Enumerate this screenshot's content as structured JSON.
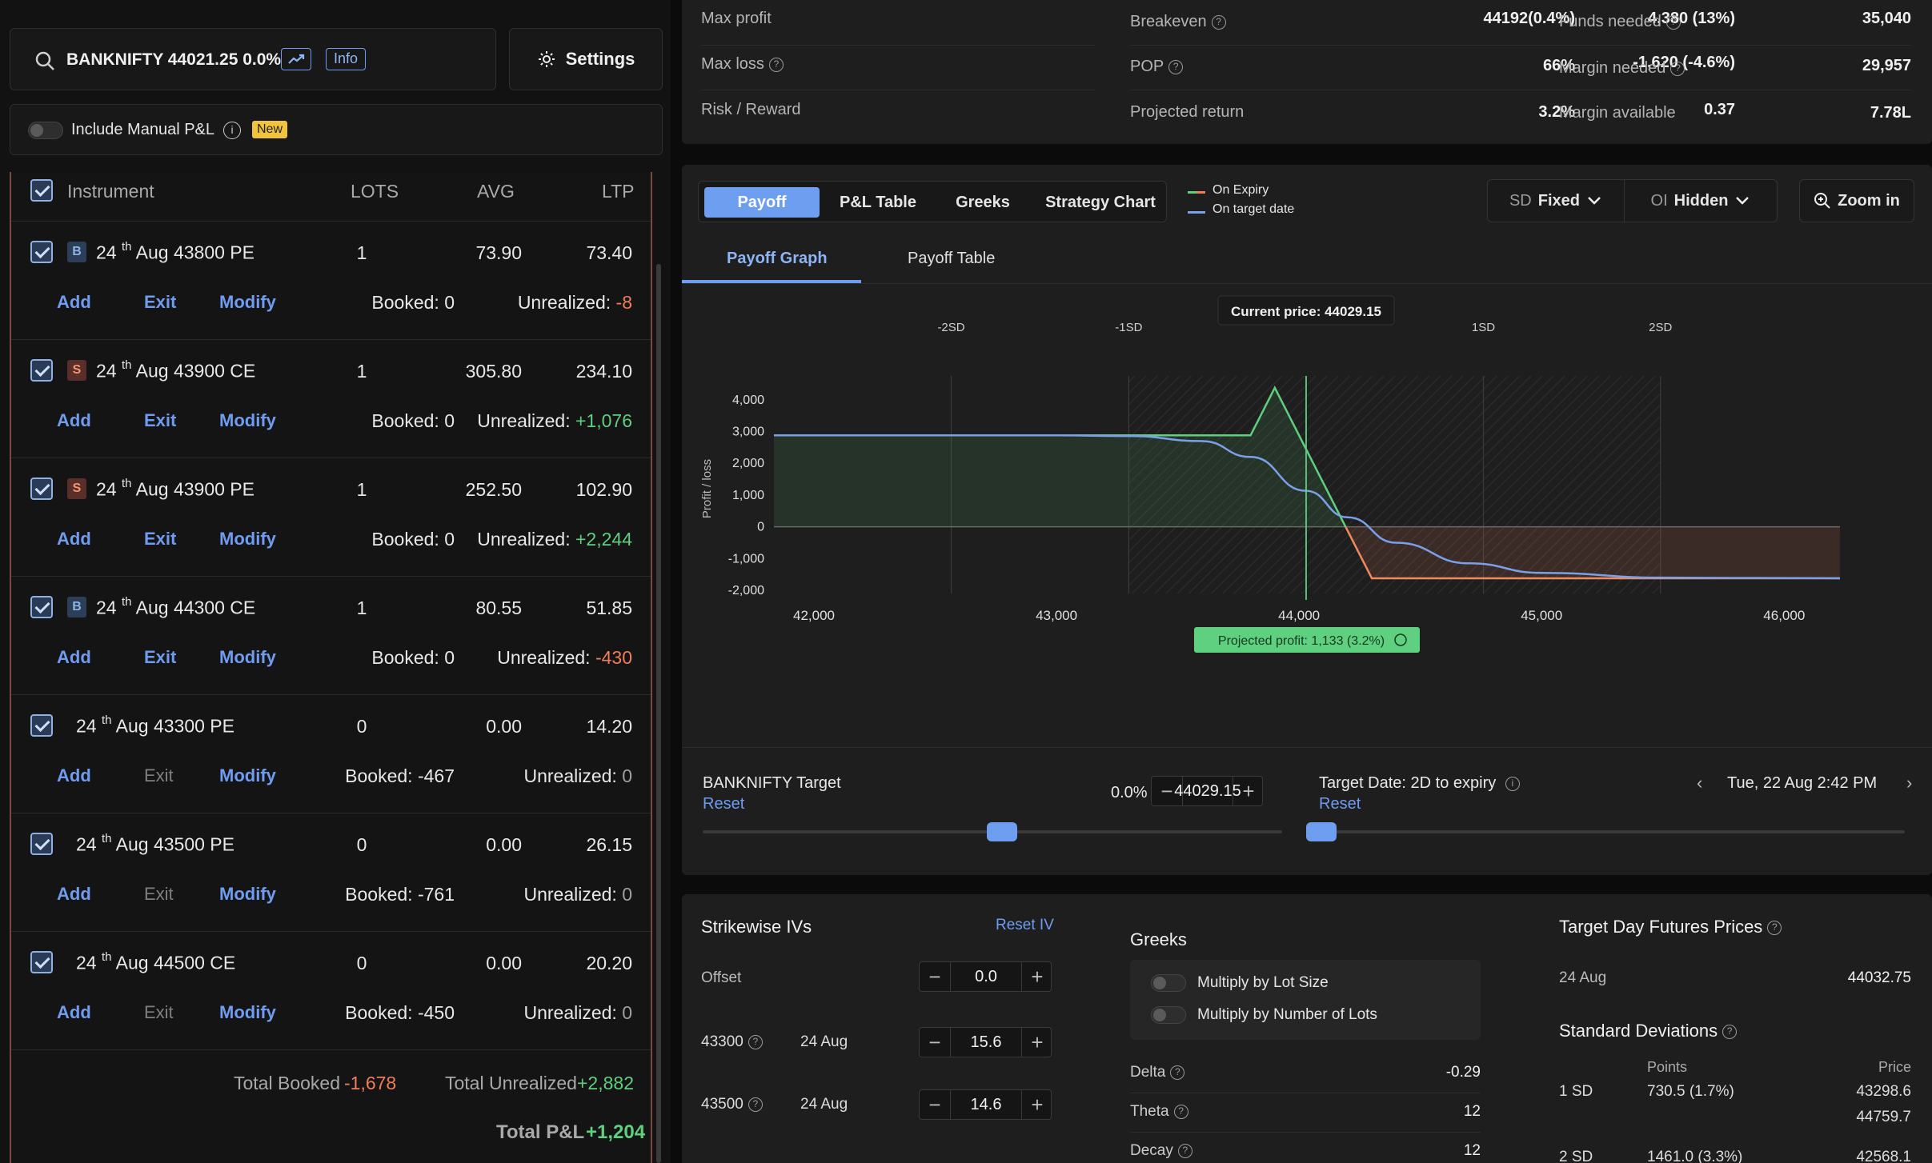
{
  "search": {
    "text": "BANKNIFTY 44021.25 0.0%",
    "info_label": "Info"
  },
  "settings_label": "Settings",
  "manual_pnl": {
    "label": "Include Manual P&L",
    "badge": "New"
  },
  "table": {
    "headers": {
      "instrument": "Instrument",
      "lots": "LOTS",
      "avg": "AVG",
      "ltp": "LTP"
    },
    "rows": [
      {
        "side": "B",
        "day": "24",
        "sup": "th",
        "rest": "Aug 43800 PE",
        "lots": "1",
        "avg": "73.90",
        "ltp": "73.40",
        "booked_label": "Booked:",
        "booked": "0",
        "unreal_label": "Unrealized:",
        "unreal": "-8",
        "unreal_color": "red",
        "exit_enabled": true
      },
      {
        "side": "S",
        "day": "24",
        "sup": "th",
        "rest": "Aug 43900 CE",
        "lots": "1",
        "avg": "305.80",
        "ltp": "234.10",
        "booked_label": "Booked:",
        "booked": "0",
        "unreal_label": "Unrealized:",
        "unreal": "+1,076",
        "unreal_color": "green",
        "exit_enabled": true
      },
      {
        "side": "S",
        "day": "24",
        "sup": "th",
        "rest": "Aug 43900 PE",
        "lots": "1",
        "avg": "252.50",
        "ltp": "102.90",
        "booked_label": "Booked:",
        "booked": "0",
        "unreal_label": "Unrealized:",
        "unreal": "+2,244",
        "unreal_color": "green",
        "exit_enabled": true
      },
      {
        "side": "B",
        "day": "24",
        "sup": "th",
        "rest": "Aug 44300 CE",
        "lots": "1",
        "avg": "80.55",
        "ltp": "51.85",
        "booked_label": "Booked:",
        "booked": "0",
        "unreal_label": "Unrealized:",
        "unreal": "-430",
        "unreal_color": "red",
        "exit_enabled": true
      },
      {
        "side": "",
        "day": "24",
        "sup": "th",
        "rest": "Aug 43300 PE",
        "lots": "0",
        "avg": "0.00",
        "ltp": "14.20",
        "booked_label": "Booked:",
        "booked": "-467",
        "unreal_label": "Unrealized:",
        "unreal": "0",
        "unreal_color": "muted",
        "exit_enabled": false
      },
      {
        "side": "",
        "day": "24",
        "sup": "th",
        "rest": "Aug 43500 PE",
        "lots": "0",
        "avg": "0.00",
        "ltp": "26.15",
        "booked_label": "Booked:",
        "booked": "-761",
        "unreal_label": "Unrealized:",
        "unreal": "0",
        "unreal_color": "muted",
        "exit_enabled": false
      },
      {
        "side": "",
        "day": "24",
        "sup": "th",
        "rest": "Aug 44500 CE",
        "lots": "0",
        "avg": "0.00",
        "ltp": "20.20",
        "booked_label": "Booked:",
        "booked": "-450",
        "unreal_label": "Unrealized:",
        "unreal": "0",
        "unreal_color": "muted",
        "exit_enabled": false
      }
    ],
    "actions": {
      "add": "Add",
      "exit": "Exit",
      "modify": "Modify"
    },
    "totals": {
      "booked_label": "Total Booked",
      "booked": "-1,678",
      "unreal_label": "Total Unrealized",
      "unreal": "+2,882",
      "pnl_label": "Total P&L",
      "pnl": "+1,204"
    }
  },
  "stats": {
    "max_profit": {
      "label": "Max profit",
      "value": "4,380 (13%)"
    },
    "max_loss": {
      "label": "Max loss",
      "value": "-1,620 (-4.6%)"
    },
    "risk_reward": {
      "label": "Risk / Reward",
      "value": "0.37"
    },
    "breakeven": {
      "label": "Breakeven",
      "value": "44192(0.4%)"
    },
    "pop": {
      "label": "POP",
      "value": "66%"
    },
    "projected_return": {
      "label": "Projected return",
      "value": "3.2%"
    },
    "funds_needed": {
      "label": "Funds needed",
      "value": "35,040"
    },
    "margin_needed": {
      "label": "Margin needed",
      "value": "29,957"
    },
    "margin_available": {
      "label": "Margin available",
      "value": "7.78L"
    }
  },
  "chart_tabs": [
    "Payoff",
    "P&L Table",
    "Greeks",
    "Strategy Chart"
  ],
  "legend": {
    "expiry": "On Expiry",
    "target": "On target date"
  },
  "sd_select": {
    "prefix": "SD",
    "value": "Fixed"
  },
  "oi_select": {
    "prefix": "OI",
    "value": "Hidden"
  },
  "zoom_label": "Zoom in",
  "subtabs": [
    "Payoff Graph",
    "Payoff Table"
  ],
  "chart_data": {
    "type": "line",
    "current_price_label": "Current price: 44029.15",
    "current_price": 44029.15,
    "ylabel": "Profit / loss",
    "xlim": [
      41835,
      46230
    ],
    "ylim": [
      -2100,
      4500
    ],
    "x_ticks": [
      "42,000",
      "43,000",
      "44,000",
      "45,000",
      "46,000"
    ],
    "x_tick_values": [
      42000,
      43000,
      44000,
      45000,
      46000
    ],
    "y_ticks": [
      "4,000",
      "3,000",
      "2,000",
      "1,000",
      "0",
      "-1,000",
      "-2,000"
    ],
    "y_tick_values": [
      4000,
      3000,
      2000,
      1000,
      0,
      -1000,
      -2000
    ],
    "sd_labels": [
      "-2SD",
      "-1SD",
      "1SD",
      "2SD"
    ],
    "sd_values": [
      42566,
      43298,
      44760,
      45490
    ],
    "series": [
      {
        "name": "On Expiry",
        "color": "#5ed07f",
        "x": [
          41835,
          43800,
          43900,
          44192,
          44300,
          46230
        ],
        "y": [
          2880,
          2880,
          4380,
          0,
          -1620,
          -1620
        ]
      },
      {
        "name": "On target date",
        "color": "#7aa0e8",
        "x": [
          41835,
          43000,
          43300,
          43600,
          43800,
          44029,
          44200,
          44400,
          44700,
          45000,
          45500,
          46230
        ],
        "y": [
          2880,
          2880,
          2860,
          2700,
          2200,
          1133,
          300,
          -500,
          -1150,
          -1450,
          -1600,
          -1620
        ]
      }
    ],
    "projected_label": "Projected profit: 1,133 (3.2%)"
  },
  "target": {
    "label": "BANKNIFTY Target",
    "reset": "Reset",
    "pct": "0.0%",
    "value": "44029.15",
    "date_label": "Target Date:",
    "date_sub": "2D to expiry",
    "date_value": "Tue, 22 Aug 2:42 PM",
    "price_slider_level": 0.49,
    "date_slider_level": 0.0
  },
  "iv": {
    "title": "Strikewise IVs",
    "reset": "Reset IV",
    "offset_label": "Offset",
    "offset": "0.0",
    "rows": [
      {
        "strike": "43300",
        "date": "24 Aug",
        "value": "15.6"
      },
      {
        "strike": "43500",
        "date": "24 Aug",
        "value": "14.6"
      }
    ]
  },
  "greeks": {
    "title": "Greeks",
    "mult_lot": "Multiply by Lot Size",
    "mult_num": "Multiply by Number of Lots",
    "rows": [
      {
        "label": "Delta",
        "value": "-0.29"
      },
      {
        "label": "Theta",
        "value": "12"
      },
      {
        "label": "Decay",
        "value": "12"
      }
    ]
  },
  "futures": {
    "title": "Target Day Futures Prices",
    "date": "24 Aug",
    "price": "44032.75",
    "sd_title": "Standard Deviations",
    "col_points": "Points",
    "col_price": "Price",
    "rows": [
      {
        "label": "1 SD",
        "points": "730.5 (1.7%)",
        "price_low": "43298.6",
        "price_high": "44759.7"
      },
      {
        "label": "2 SD",
        "points": "1461.0 (3.3%)",
        "price_low": "42568.1"
      }
    ]
  }
}
